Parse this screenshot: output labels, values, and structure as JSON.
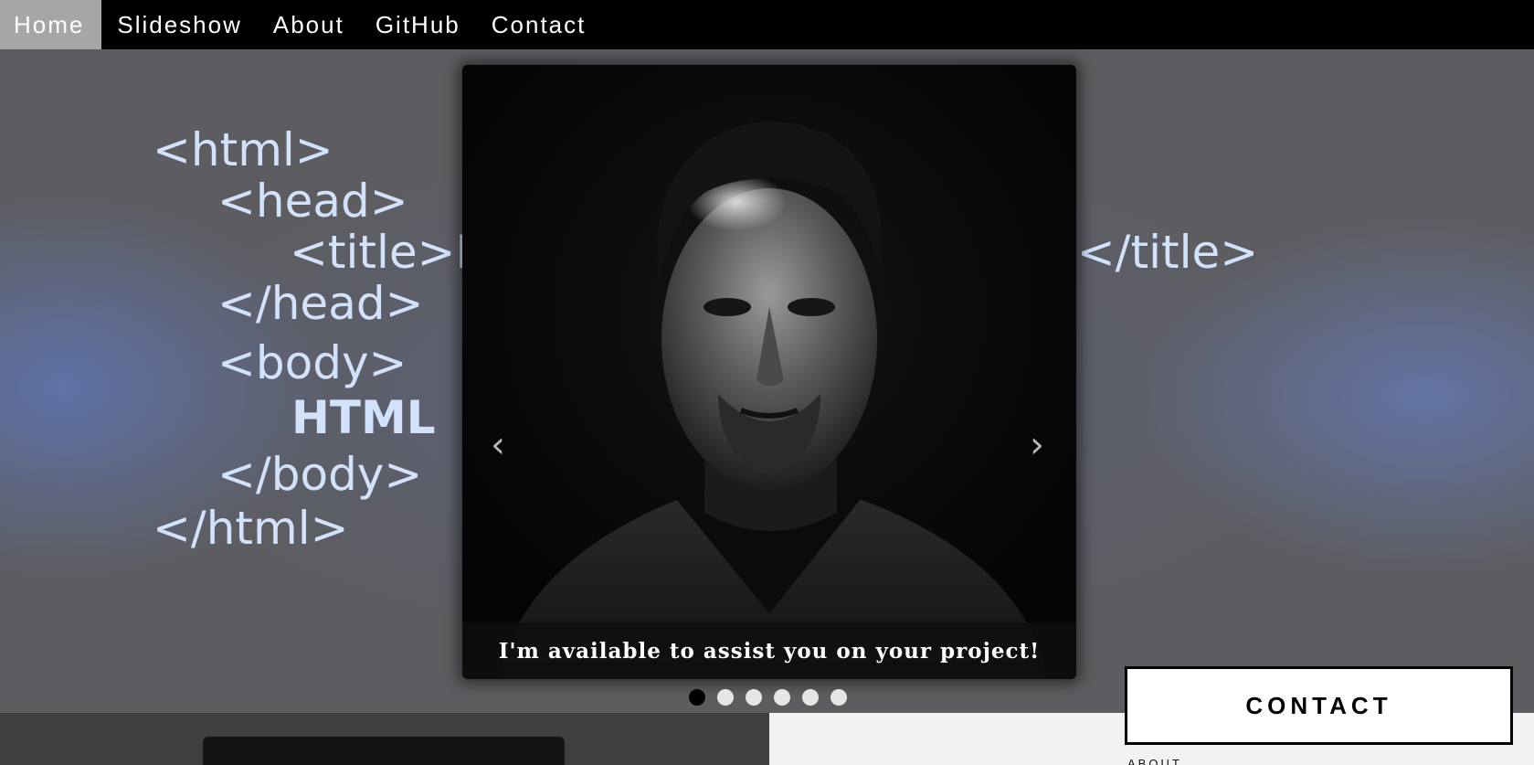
{
  "nav": {
    "items": [
      {
        "label": "Home",
        "active": true
      },
      {
        "label": "Slideshow",
        "active": false
      },
      {
        "label": "About",
        "active": false
      },
      {
        "label": "GitHub",
        "active": false
      },
      {
        "label": "Contact",
        "active": false
      }
    ]
  },
  "hero": {
    "code_lines": {
      "html_open": "<html>",
      "head_open": "<head>",
      "title_open": "<title>H",
      "title_close": "e</title>",
      "head_close": "</head>",
      "body_open": "<body>",
      "body_text": "HTML",
      "body_close": "</body>",
      "html_close": "</html>"
    },
    "text_color": "#d3e2fb"
  },
  "slideshow": {
    "prev_icon": "‹",
    "next_icon": "›",
    "caption": "I'm available to assist you on your project!",
    "slide_count": 6,
    "active_index": 0
  },
  "contact": {
    "button_label": "CONTACT",
    "about_label": "ABOUT"
  },
  "colors": {
    "nav_bg": "#000000",
    "nav_active": "#a6a6a6",
    "hero_accent": "#5f76b2"
  }
}
